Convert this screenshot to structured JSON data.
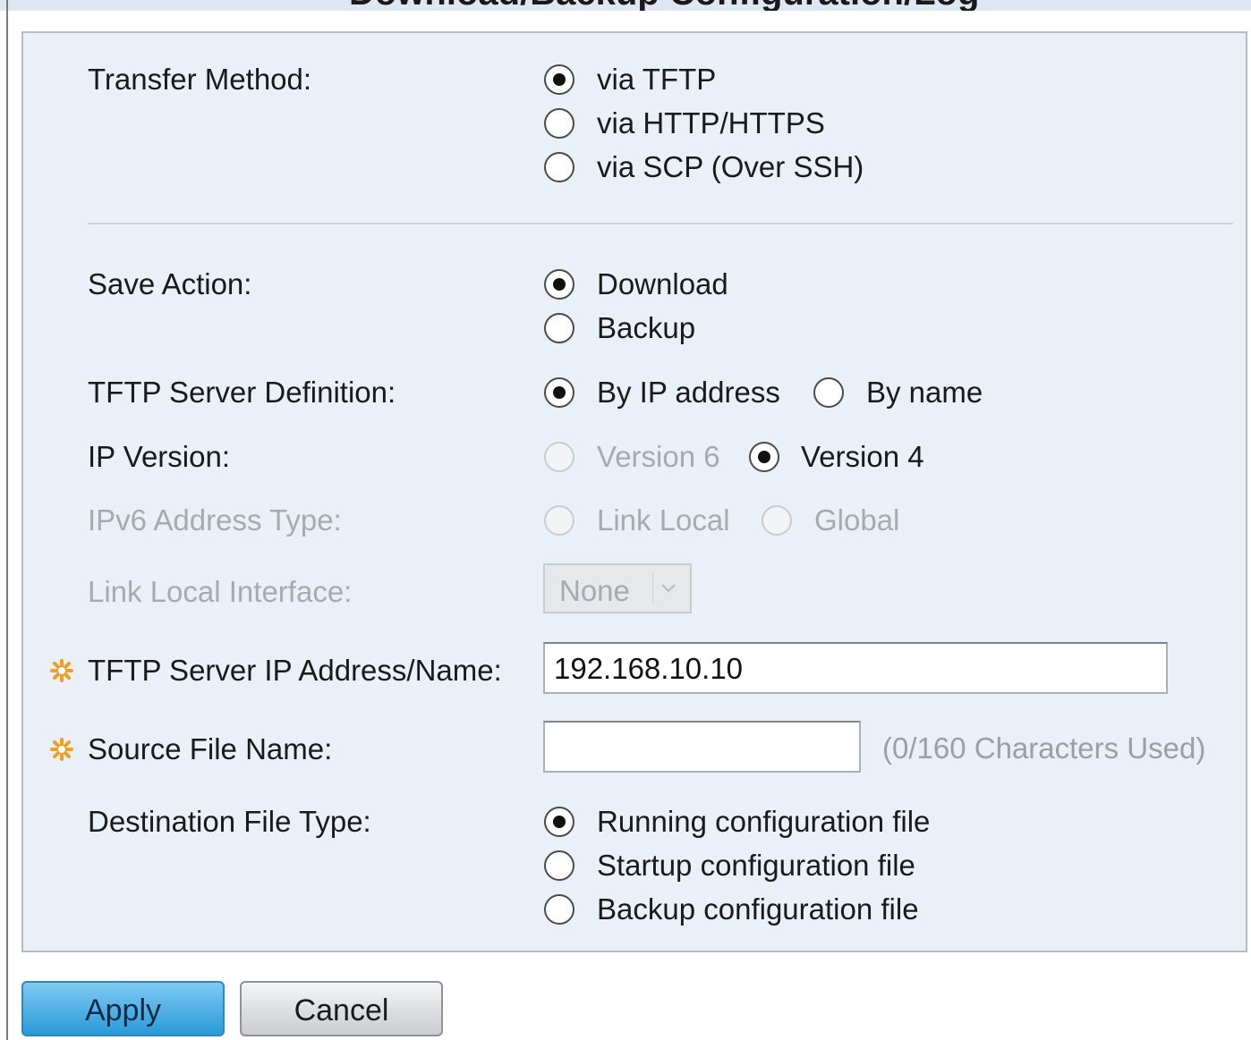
{
  "page": {
    "title": "Download/Backup Configuration/Log"
  },
  "form": {
    "transfer_method": {
      "label": "Transfer Method:",
      "options": [
        "via TFTP",
        "via HTTP/HTTPS",
        "via SCP (Over SSH)"
      ],
      "selected": "via TFTP"
    },
    "save_action": {
      "label": "Save Action:",
      "options": [
        "Download",
        "Backup"
      ],
      "selected": "Download"
    },
    "tftp_server_definition": {
      "label": "TFTP Server Definition:",
      "options": [
        "By IP address",
        "By name"
      ],
      "selected": "By IP address"
    },
    "ip_version": {
      "label": "IP Version:",
      "options": [
        "Version 6",
        "Version 4"
      ],
      "selected": "Version 4",
      "disabled_options": [
        "Version 6"
      ]
    },
    "ipv6_address_type": {
      "label": "IPv6 Address Type:",
      "options": [
        "Link Local",
        "Global"
      ],
      "disabled": true
    },
    "link_local_interface": {
      "label": "Link Local Interface:",
      "value": "None",
      "disabled": true
    },
    "tftp_server_address": {
      "label": "TFTP Server IP Address/Name:",
      "value": "192.168.10.10",
      "required": true
    },
    "source_file_name": {
      "label": "Source File Name:",
      "value": "",
      "hint": "(0/160 Characters Used)",
      "required": true
    },
    "destination_file_type": {
      "label": "Destination File Type:",
      "options": [
        "Running configuration file",
        "Startup configuration file",
        "Backup configuration file"
      ],
      "selected": "Running configuration file"
    }
  },
  "buttons": {
    "apply": "Apply",
    "cancel": "Cancel"
  },
  "colors": {
    "panel_background": "#eaf0f7",
    "required_star": "#f0a020",
    "apply_button": "#2a9ad9",
    "disabled_text": "#a6abb1"
  }
}
